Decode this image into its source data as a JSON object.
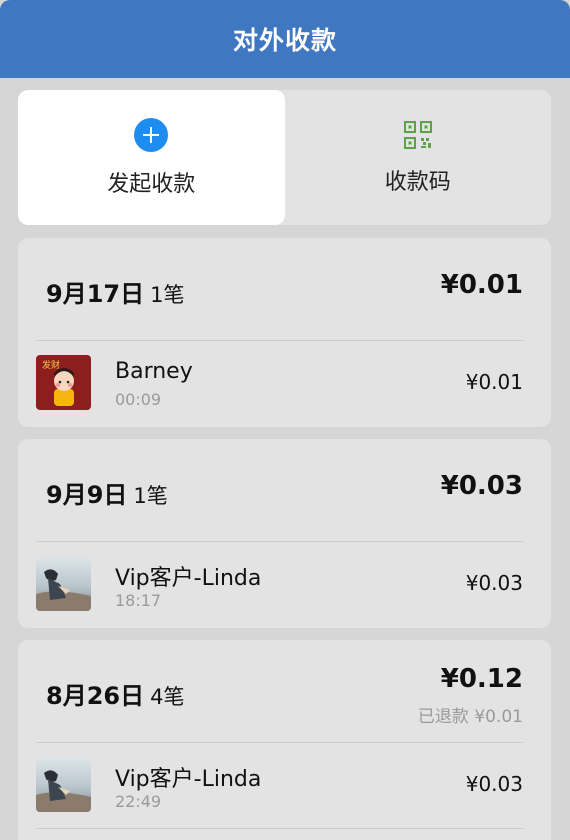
{
  "header": {
    "title": "对外收款"
  },
  "actions": {
    "start": {
      "label": "发起收款",
      "icon": "plus-circle-icon",
      "color": "#1e8cf0"
    },
    "qrcode": {
      "label": "收款码",
      "icon": "qr-code-icon",
      "color": "#5fa145"
    }
  },
  "groups": [
    {
      "date": "9月17日",
      "count": "1笔",
      "total": "¥0.01",
      "refund": "",
      "items": [
        {
          "name": "Barney",
          "time": "00:09",
          "amount": "¥0.01",
          "avatar": "red-cartoon-avatar",
          "avatar_text": "发财"
        }
      ]
    },
    {
      "date": "9月9日",
      "count": "1笔",
      "total": "¥0.03",
      "refund": "",
      "items": [
        {
          "name": "Vip客户-Linda",
          "time": "18:17",
          "amount": "¥0.03",
          "avatar": "photo-avatar"
        }
      ]
    },
    {
      "date": "8月26日",
      "count": "4笔",
      "total": "¥0.12",
      "refund": "已退款 ¥0.01",
      "items": [
        {
          "name": "Vip客户-Linda",
          "time": "22:49",
          "amount": "¥0.03",
          "avatar": "photo-avatar"
        }
      ]
    }
  ]
}
